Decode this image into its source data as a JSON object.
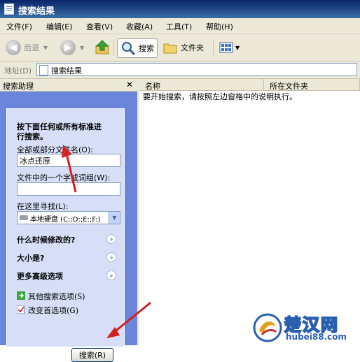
{
  "window": {
    "title": "搜索结果"
  },
  "menu": [
    "文件(F)",
    "编辑(E)",
    "查看(V)",
    "收藏(A)",
    "工具(T)",
    "帮助(H)"
  ],
  "toolbar": {
    "back": "后退",
    "search": "搜索",
    "folders": "文件夹"
  },
  "address": {
    "label": "地址(D)",
    "value": "搜索结果"
  },
  "left_pane": {
    "title": "搜索助理",
    "close_glyph": "✕",
    "intro": [
      "按下面任何或所有标准进",
      "行搜索。"
    ],
    "filename_label": "全部或部分文件名(O):",
    "filename_value": "冰点还原",
    "phrase_label": "文件中的一个字或词组(W):",
    "phrase_value": "",
    "lookin_label": "在这里寻找(L):",
    "lookin_value": "本地硬盘 (C:;D:;E:;F:)",
    "sections": [
      "什么时候修改的?",
      "大小是?",
      "更多高级选项"
    ],
    "links": [
      "其他搜索选项(S)",
      "改变首选项(G)"
    ],
    "search_button": "搜索(R)"
  },
  "results": {
    "columns": [
      "名称",
      "所在文件夹"
    ],
    "empty_message": "要开始搜索，请按照左边窗格中的说明执行。"
  },
  "watermark": {
    "brand": "楚汉网",
    "url": "hubei88.com"
  },
  "colors": {
    "title_bar": "#0a246a",
    "pane_blue": "#6b85dc",
    "panel": "#d6dff7",
    "arrow": "#d42020"
  }
}
